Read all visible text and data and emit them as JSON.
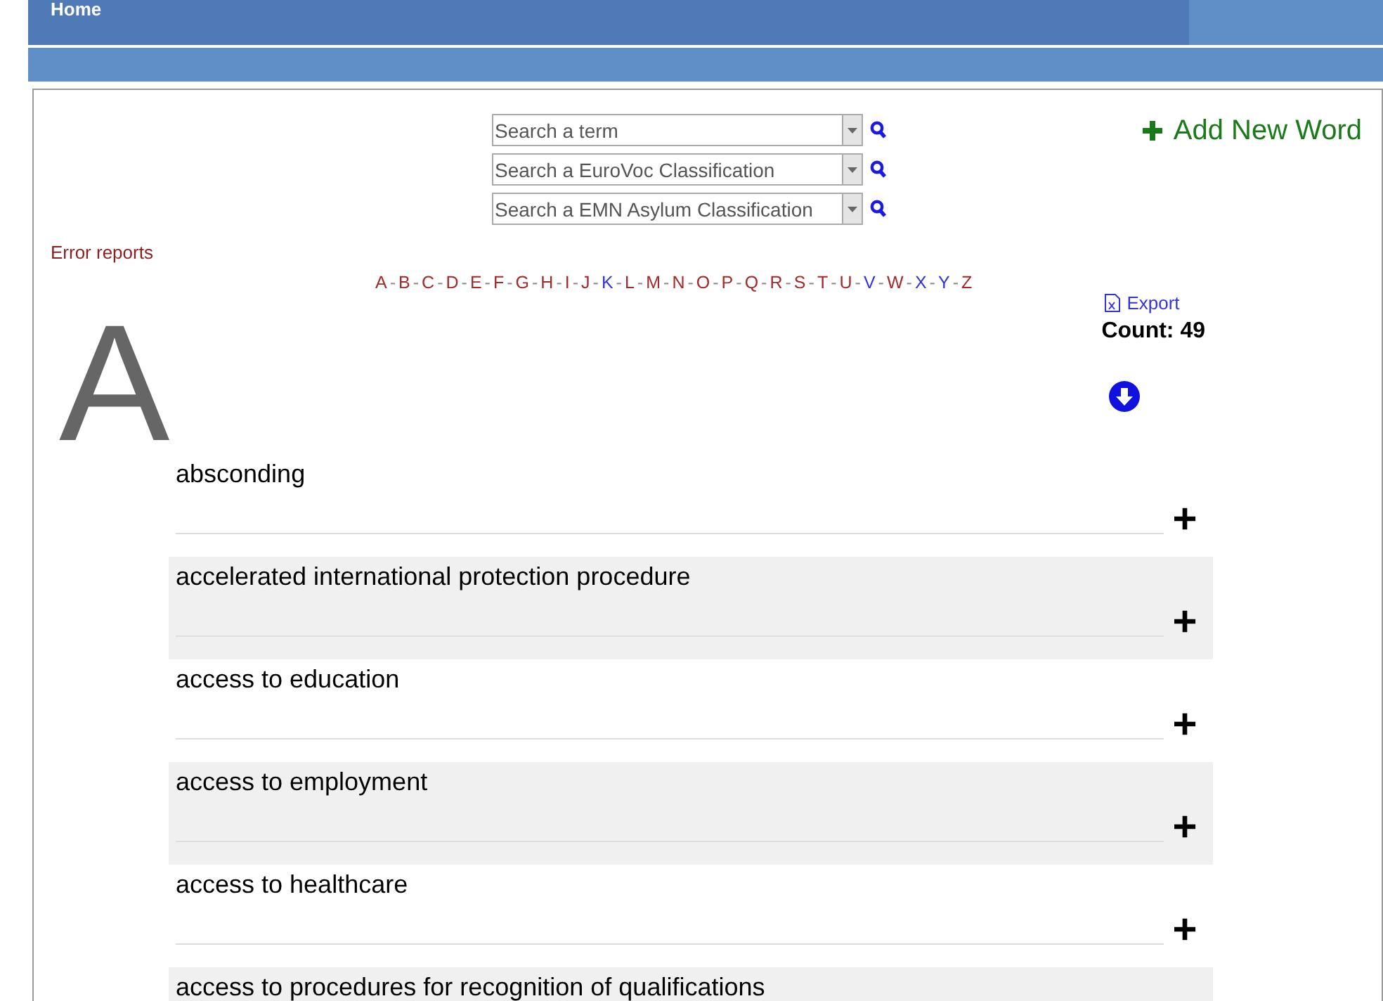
{
  "nav": {
    "home": "Home"
  },
  "search_fields": [
    {
      "placeholder": "Search a term"
    },
    {
      "placeholder": "Search a EuroVoc Classification"
    },
    {
      "placeholder": "Search a EMN Asylum Classification"
    }
  ],
  "add_new_word": "Add New Word",
  "error_reports": "Error reports",
  "letters": [
    {
      "label": "A",
      "color": "#a52a2a"
    },
    {
      "label": "B",
      "color": "#a52a2a"
    },
    {
      "label": "C",
      "color": "#a52a2a"
    },
    {
      "label": "D",
      "color": "#a52a2a"
    },
    {
      "label": "E",
      "color": "#a52a2a"
    },
    {
      "label": "F",
      "color": "#a52a2a"
    },
    {
      "label": "G",
      "color": "#a52a2a"
    },
    {
      "label": "H",
      "color": "#a52a2a"
    },
    {
      "label": "I",
      "color": "#a52a2a"
    },
    {
      "label": "J",
      "color": "#a52a2a"
    },
    {
      "label": "K",
      "color": "#3333dd"
    },
    {
      "label": "L",
      "color": "#a52a2a"
    },
    {
      "label": "M",
      "color": "#a52a2a"
    },
    {
      "label": "N",
      "color": "#a52a2a"
    },
    {
      "label": "O",
      "color": "#a52a2a"
    },
    {
      "label": "P",
      "color": "#a52a2a"
    },
    {
      "label": "Q",
      "color": "#a52a2a"
    },
    {
      "label": "R",
      "color": "#a52a2a"
    },
    {
      "label": "S",
      "color": "#a52a2a"
    },
    {
      "label": "T",
      "color": "#a52a2a"
    },
    {
      "label": "U",
      "color": "#a52a2a"
    },
    {
      "label": "V",
      "color": "#3333dd"
    },
    {
      "label": "W",
      "color": "#a52a2a"
    },
    {
      "label": "X",
      "color": "#3333dd"
    },
    {
      "label": "Y",
      "color": "#3333dd"
    },
    {
      "label": "Z",
      "color": "#a52a2a"
    }
  ],
  "letter_separator": "-",
  "export": "Export",
  "count": "Count: 49",
  "current_letter": "A",
  "terms": [
    {
      "term": "absconding",
      "expand": "+"
    },
    {
      "term": "accelerated international protection procedure",
      "expand": "+"
    },
    {
      "term": "access to education",
      "expand": "+"
    },
    {
      "term": "access to employment",
      "expand": "+"
    },
    {
      "term": "access to healthcare",
      "expand": "+"
    },
    {
      "term": "access to procedures for recognition of qualifications"
    }
  ]
}
